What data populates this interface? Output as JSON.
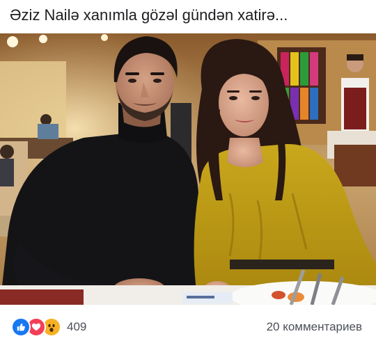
{
  "post": {
    "text": "Əziz Nailə xanımla gözəl gündən xatirə..."
  },
  "photo": {
    "subject": "photo"
  },
  "footer": {
    "reactions": {
      "icons": [
        "like-icon",
        "love-icon",
        "wow-icon"
      ],
      "count": "409"
    },
    "comments_label": "20 комментариев"
  },
  "colors": {
    "like": "#1877f2",
    "love": "#f33e58",
    "wow": "#f7b125",
    "text": "#1c1e21",
    "meta": "#4b4f56"
  }
}
